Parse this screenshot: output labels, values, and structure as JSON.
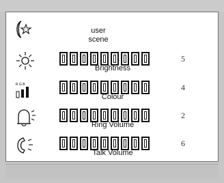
{
  "screen": {
    "title_line1": "user",
    "title_line2": "scene"
  },
  "rows": [
    {
      "icon": "brightness-sun-icon",
      "label": "Brightness",
      "value": "5",
      "segments": 9
    },
    {
      "icon": "rgb-bars-icon",
      "label": "Colour",
      "value": "4",
      "segments": 9
    },
    {
      "icon": "bell-ringing-icon",
      "label": "Ring Volume",
      "value": "2",
      "segments": 9
    },
    {
      "icon": "phone-handset-icon",
      "label": "Talk Volume",
      "value": "6",
      "segments": 9
    }
  ],
  "icons": {
    "scene": "moon-star-icon",
    "rgb_text": "R G B"
  },
  "colors": {
    "frame": "#c6c6c6",
    "screen": "#ffffff",
    "ink": "#111111"
  }
}
